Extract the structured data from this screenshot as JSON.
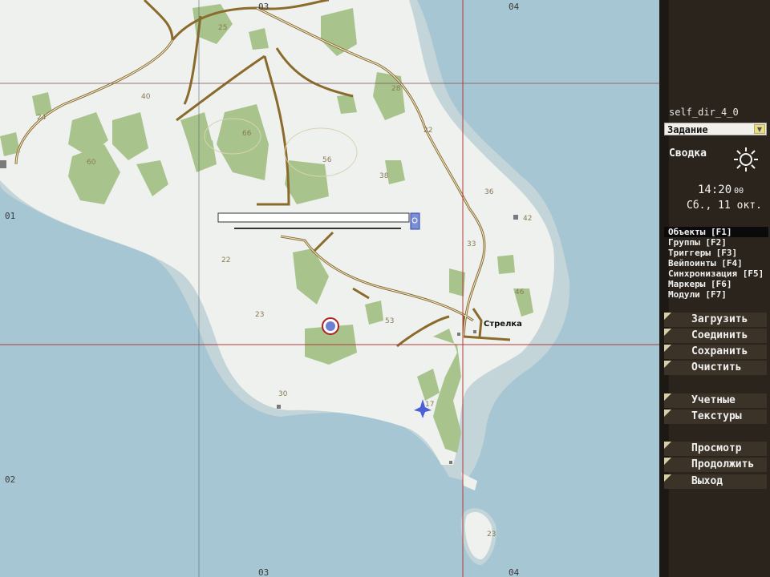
{
  "map": {
    "grid_labels": {
      "top": [
        "03",
        "04"
      ],
      "bottom": [
        "03",
        "04"
      ],
      "left": [
        "01",
        "02"
      ]
    },
    "elevations": [
      "25",
      "40",
      "24",
      "60",
      "66",
      "56",
      "28",
      "22",
      "38",
      "36",
      "42",
      "33",
      "22",
      "46",
      "23",
      "53",
      "30",
      "17",
      "23"
    ],
    "town": "Стрелка"
  },
  "panel": {
    "mission_name": "self_dir_4_0",
    "dropdown_value": "Задание",
    "briefing_title": "Сводка",
    "time_main": "14:20",
    "time_seconds": "00",
    "date": "Сб., 11 окт.",
    "modes": [
      {
        "label": "Объекты [F1]",
        "active": true
      },
      {
        "label": "Группы [F2]",
        "active": false
      },
      {
        "label": "Триггеры [F3]",
        "active": false
      },
      {
        "label": "Вейпоинты [F4]",
        "active": false
      },
      {
        "label": "Синхронизация [F5]",
        "active": false
      },
      {
        "label": "Маркеры [F6]",
        "active": false
      },
      {
        "label": "Модули [F7]",
        "active": false
      }
    ],
    "buttons": {
      "load": "Загрузить",
      "merge": "Соединить",
      "save": "Сохранить",
      "clear": "Очистить",
      "intel": "Учетные",
      "textures": "Текстуры",
      "preview": "Просмотр",
      "continue": "Продолжить",
      "exit": "Выход"
    }
  },
  "colors": {
    "sea": "#a7c6d3",
    "land": "#eef1ee",
    "forest": "#a8c48c",
    "road": "#8a6b2c",
    "gridline": "#b03a3a",
    "panel": "#2a241c"
  }
}
